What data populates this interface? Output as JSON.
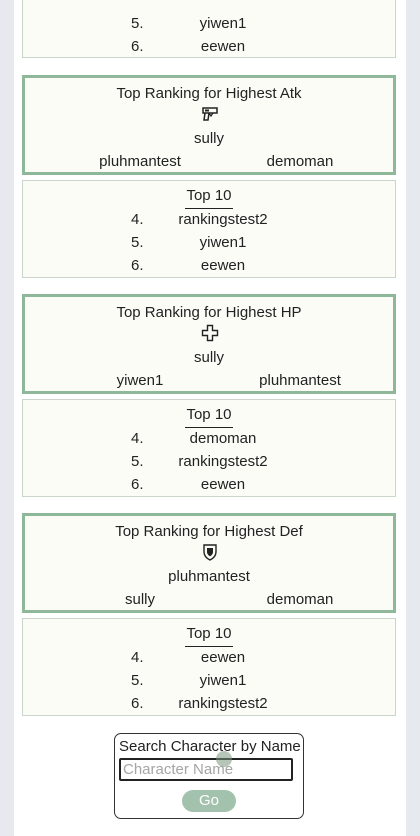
{
  "rankings": [
    {
      "list": {
        "title": "",
        "rows": [
          {
            "rank": "5.",
            "name": "yiwen1"
          },
          {
            "rank": "6.",
            "name": "eewen"
          }
        ]
      }
    },
    {
      "podium": {
        "title": "Top Ranking for Highest Atk",
        "icon": "gun-icon",
        "first": "sully",
        "second": "pluhmantest",
        "third": "demoman"
      },
      "list": {
        "title": "Top 10",
        "rows": [
          {
            "rank": "4.",
            "name": "rankingstest2"
          },
          {
            "rank": "5.",
            "name": "yiwen1"
          },
          {
            "rank": "6.",
            "name": "eewen"
          }
        ]
      }
    },
    {
      "podium": {
        "title": "Top Ranking for Highest HP",
        "icon": "health-cross-icon",
        "first": "sully",
        "second": "yiwen1",
        "third": "pluhmantest"
      },
      "list": {
        "title": "Top 10",
        "rows": [
          {
            "rank": "4.",
            "name": "demoman"
          },
          {
            "rank": "5.",
            "name": "rankingstest2"
          },
          {
            "rank": "6.",
            "name": "eewen"
          }
        ]
      }
    },
    {
      "podium": {
        "title": "Top Ranking for Highest Def",
        "icon": "shield-icon",
        "first": "pluhmantest",
        "second": "sully",
        "third": "demoman"
      },
      "list": {
        "title": "Top 10",
        "rows": [
          {
            "rank": "4.",
            "name": "eewen"
          },
          {
            "rank": "5.",
            "name": "yiwen1"
          },
          {
            "rank": "6.",
            "name": "rankingstest2"
          }
        ]
      }
    }
  ],
  "search": {
    "label": "Search Character by Name",
    "placeholder": "Character Name",
    "value": "",
    "button_label": "Go"
  },
  "colors": {
    "accent_border": "#8fb79a",
    "button_bg": "#a3c2ad",
    "card_bg": "#fcfcf7",
    "page_bg": "#e6e9ee"
  }
}
